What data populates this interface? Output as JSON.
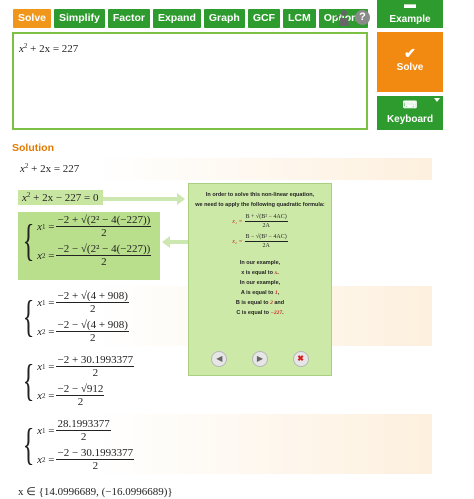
{
  "tabs": [
    {
      "label": "Solve",
      "active": true
    },
    {
      "label": "Simplify",
      "active": false
    },
    {
      "label": "Factor",
      "active": false
    },
    {
      "label": "Expand",
      "active": false
    },
    {
      "label": "Graph",
      "active": false
    },
    {
      "label": "GCF",
      "active": false
    },
    {
      "label": "LCM",
      "active": false
    },
    {
      "label": "Options",
      "active": false
    }
  ],
  "help_label": "?",
  "editor": {
    "input_lhs": "x",
    "input_exp": "2",
    "input_rest": " + 2x = 227"
  },
  "side_buttons": {
    "example": "Example",
    "solve": "Solve",
    "keyboard": "Keyboard"
  },
  "solution": {
    "title": "Solution",
    "step1": {
      "lhs": "x",
      "exp": "2",
      "rest": " + 2x = 227"
    },
    "step2": {
      "lhs": "x",
      "exp": "2",
      "rest": " + 2x − 227 = 0"
    },
    "sys1": {
      "x1_num": "−2 + √(2² − 4(−227))",
      "x2_num": "−2 − √(2² − 4(−227))",
      "den": "2"
    },
    "sys2": {
      "x1_num": "−2 + √(4 + 908)",
      "x2_num": "−2 − √(4 + 908)",
      "den": "2"
    },
    "sys3": {
      "x1_num": "−2 + 30.1993377",
      "x2_num": "−2 − √912",
      "den": "2"
    },
    "sys4": {
      "x1_num": "28.1993377",
      "x2_num": "−2 − 30.1993377",
      "den": "2"
    },
    "final": "x ∈ {14.0996689, (−16.0996689)}"
  },
  "popup": {
    "line1": "In order to solve this non-linear equation,",
    "line2": "we need to apply the following quadratic formula:",
    "f1_lhs": "x₁ =",
    "f1_num": "B + √(B² − 4AC)",
    "f1_den": "2A",
    "f2_lhs": "x₂ =",
    "f2_num": "B − √(B² − 4AC)",
    "f2_den": "2A",
    "intro": "In our example,",
    "x_line_pre": "x is equal to",
    "x_line_val": "x",
    "intro2": "In our example,",
    "a_line_pre": "A is equal to",
    "a_line_val": "1",
    "b_line_pre": "B is equal to",
    "b_line_val": "2",
    "b_line_suffix": "and",
    "c_line_pre": "C is equal to",
    "c_line_val": "−227"
  }
}
